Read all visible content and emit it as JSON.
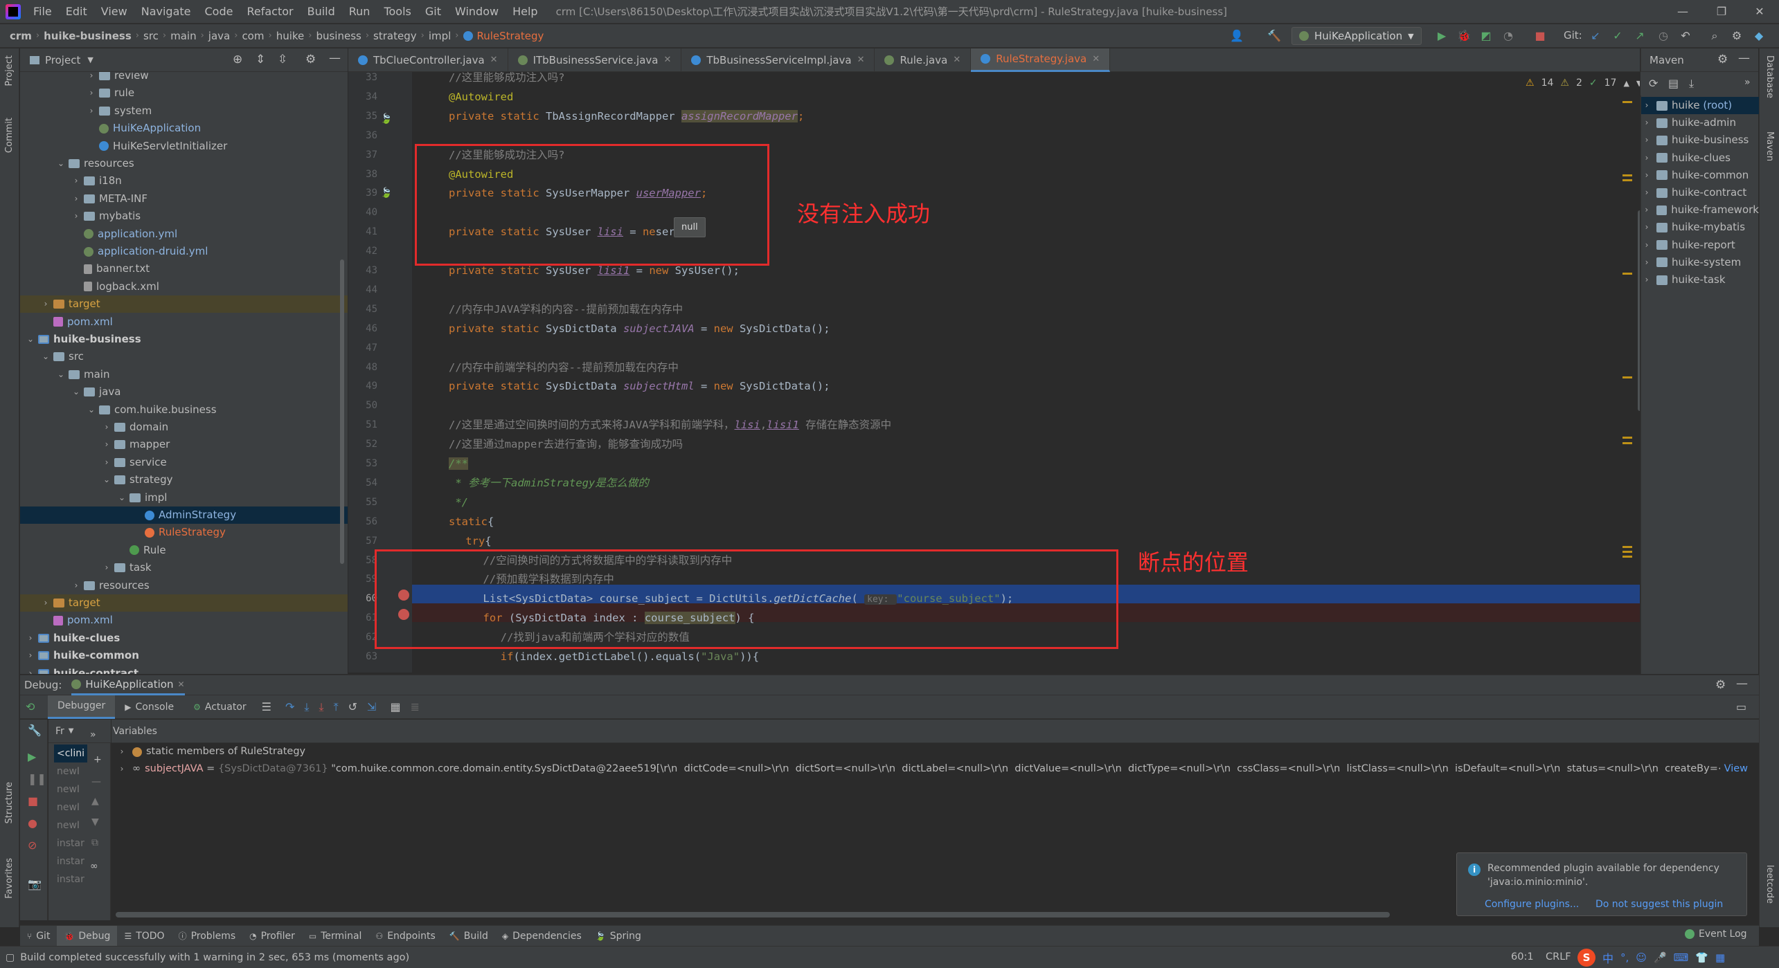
{
  "menu": {
    "items": [
      "File",
      "Edit",
      "View",
      "Navigate",
      "Code",
      "Refactor",
      "Build",
      "Run",
      "Tools",
      "Git",
      "Window",
      "Help"
    ],
    "title": "crm [C:\\Users\\86150\\Desktop\\工作\\沉浸式项目实战\\沉浸式项目实战V1.2\\代码\\第一天代码\\prd\\crm] - RuleStrategy.java [huike-business]"
  },
  "nav": {
    "crumbs": [
      "crm",
      "huike-business",
      "src",
      "main",
      "java",
      "com",
      "huike",
      "business",
      "strategy",
      "impl",
      "RuleStrategy"
    ],
    "run_config": "HuiKeApplication",
    "git_label": "Git:"
  },
  "left_strip": {
    "project": "Project",
    "commit": "Commit",
    "structure": "Structure",
    "favorites": "Favorites"
  },
  "right_strip": {
    "database": "Database",
    "maven": "Maven",
    "leetcode": "leetcode"
  },
  "project": {
    "title": "Project",
    "tree": [
      {
        "indent": 4,
        "chev": "›",
        "icon": "folder",
        "label": "review"
      },
      {
        "indent": 4,
        "chev": "›",
        "icon": "folder",
        "label": "rule"
      },
      {
        "indent": 4,
        "chev": "›",
        "icon": "folder",
        "label": "system"
      },
      {
        "indent": 4,
        "chev": "",
        "icon": "spring",
        "label": "HuiKeApplication",
        "cls": "blue"
      },
      {
        "indent": 4,
        "chev": "",
        "icon": "class",
        "label": "HuiKeServletInitializer"
      },
      {
        "indent": 2,
        "chev": "⌄",
        "icon": "folder",
        "label": "resources"
      },
      {
        "indent": 3,
        "chev": "›",
        "icon": "folder",
        "label": "i18n"
      },
      {
        "indent": 3,
        "chev": "›",
        "icon": "folder",
        "label": "META-INF"
      },
      {
        "indent": 3,
        "chev": "›",
        "icon": "folder",
        "label": "mybatis"
      },
      {
        "indent": 3,
        "chev": "",
        "icon": "spring",
        "label": "application.yml",
        "cls": "blue"
      },
      {
        "indent": 3,
        "chev": "",
        "icon": "spring",
        "label": "application-druid.yml",
        "cls": "blue"
      },
      {
        "indent": 3,
        "chev": "",
        "icon": "file",
        "label": "banner.txt"
      },
      {
        "indent": 3,
        "chev": "",
        "icon": "file",
        "label": "logback.xml"
      },
      {
        "indent": 1,
        "chev": "›",
        "icon": "folder-o",
        "label": "target",
        "cls": "orange",
        "row": "hl"
      },
      {
        "indent": 1,
        "chev": "",
        "icon": "mvn",
        "label": "pom.xml",
        "cls": "blue"
      },
      {
        "indent": 0,
        "chev": "⌄",
        "icon": "module",
        "label": "huike-business",
        "cls": "bold"
      },
      {
        "indent": 1,
        "chev": "⌄",
        "icon": "folder",
        "label": "src"
      },
      {
        "indent": 2,
        "chev": "⌄",
        "icon": "folder",
        "label": "main"
      },
      {
        "indent": 3,
        "chev": "⌄",
        "icon": "folder",
        "label": "java"
      },
      {
        "indent": 4,
        "chev": "⌄",
        "icon": "pkg",
        "label": "com.huike.business"
      },
      {
        "indent": 5,
        "chev": "›",
        "icon": "pkg",
        "label": "domain"
      },
      {
        "indent": 5,
        "chev": "›",
        "icon": "pkg",
        "label": "mapper"
      },
      {
        "indent": 5,
        "chev": "›",
        "icon": "pkg",
        "label": "service"
      },
      {
        "indent": 5,
        "chev": "⌄",
        "icon": "pkg",
        "label": "strategy"
      },
      {
        "indent": 6,
        "chev": "⌄",
        "icon": "pkg",
        "label": "impl"
      },
      {
        "indent": 7,
        "chev": "",
        "icon": "class",
        "label": "AdminStrategy",
        "cls": "blue",
        "row": "sel"
      },
      {
        "indent": 7,
        "chev": "",
        "icon": "class-orange",
        "label": "RuleStrategy",
        "cls": "red"
      },
      {
        "indent": 6,
        "chev": "",
        "icon": "rulecls",
        "label": "Rule"
      },
      {
        "indent": 5,
        "chev": "›",
        "icon": "pkg",
        "label": "task"
      },
      {
        "indent": 3,
        "chev": "›",
        "icon": "folder",
        "label": "resources"
      },
      {
        "indent": 1,
        "chev": "›",
        "icon": "folder-o",
        "label": "target",
        "cls": "orange",
        "row": "hl"
      },
      {
        "indent": 1,
        "chev": "",
        "icon": "mvn",
        "label": "pom.xml",
        "cls": "blue"
      },
      {
        "indent": 0,
        "chev": "›",
        "icon": "module",
        "label": "huike-clues",
        "cls": "bold"
      },
      {
        "indent": 0,
        "chev": "›",
        "icon": "module",
        "label": "huike-common",
        "cls": "bold"
      },
      {
        "indent": 0,
        "chev": "›",
        "icon": "module",
        "label": "huike-contract",
        "cls": "bold"
      }
    ]
  },
  "tabs": [
    {
      "label": "TbClueController.java",
      "icon": "cls",
      "active": false
    },
    {
      "label": "ITbBusinessService.java",
      "icon": "itf",
      "active": false
    },
    {
      "label": "TbBusinessServiceImpl.java",
      "icon": "cls",
      "active": false
    },
    {
      "label": "Rule.java",
      "icon": "itf",
      "active": false
    },
    {
      "label": "RuleStrategy.java",
      "icon": "cls",
      "active": true
    }
  ],
  "editor": {
    "inspections": {
      "warnings": "14",
      "weak": "2",
      "ok": "17"
    },
    "line_numbers": [
      "33",
      "34",
      "35",
      "36",
      "37",
      "38",
      "39",
      "40",
      "41",
      "42",
      "43",
      "44",
      "45",
      "46",
      "47",
      "48",
      "49",
      "50",
      "51",
      "52",
      "53",
      "54",
      "55",
      "56",
      "57",
      "58",
      "59",
      "60",
      "61",
      "62",
      "63"
    ],
    "lines": {
      "l33": "//这里能够成功注入吗?",
      "l34": "@Autowired",
      "l35a": "private static ",
      "l35b": "TbAssignRecordMapper ",
      "l35c": "assignRecordMapper",
      "l35d": ";",
      "l37": "//这里能够成功注入吗?",
      "l38": "@Autowired",
      "l39a": "private static ",
      "l39b": "SysUserMapper ",
      "l39c": "userMapper",
      "l39d": ";",
      "l41a": "private static ",
      "l41b": "SysUser ",
      "l41c": "lisi",
      "l41d": " = ",
      "l41e": "ne",
      "l41f": "ser();",
      "l43a": "private static ",
      "l43b": "SysUser ",
      "l43c": "lisi1",
      "l43d": " = ",
      "l43e": "new ",
      "l43f": "SysUser();",
      "l45": "//内存中JAVA学科的内容--提前预加载在内存中",
      "l46a": "private static ",
      "l46b": "SysDictData ",
      "l46c": "subjectJAVA",
      "l46d": " = ",
      "l46e": "new ",
      "l46f": "SysDictData();",
      "l48": "//内存中前端学科的内容--提前预加载在内存中",
      "l49a": "private static ",
      "l49b": "SysDictData ",
      "l49c": "subjectHtml",
      "l49d": " = ",
      "l49e": "new ",
      "l49f": "SysDictData();",
      "l51a": "//这里是通过空间换时间的方式来将JAVA学科和前端学科，",
      "l51b": "lisi",
      "l51c": ",",
      "l51d": "lisi1",
      "l51e": " 存储在静态资源中",
      "l52": "//这里通过mapper去进行查询，能够查询成功吗",
      "l53": "/**",
      "l54a": " * ",
      "l54b": "参考一下adminStrategy是怎么做的",
      "l55": " */",
      "l56a": "static",
      "l56b": "{",
      "l57a": "try",
      "l57b": "{",
      "l58": "//空间换时间的方式将数据库中的学科读取到内存中",
      "l59": "//预加载学科数据到内存中",
      "l60a": "List<SysDictData> course_subject = DictUtils.",
      "l60b": "getDictCache",
      "l60c": "( ",
      "l60d": "key: ",
      "l60e": "\"course_subject\"",
      "l60f": ");",
      "l61a": "for ",
      "l61b": "(SysDictData index : ",
      "l61c": "course_subject",
      "l61d": ") {",
      "l62": "//找到java和前端两个学科对应的数值",
      "l63a": "if",
      "l63b": "(index.getDictLabel().equals(",
      "l63c": "\"Java\"",
      "l63d": ")){"
    },
    "tooltip": "null",
    "annotation_1": "没有注入成功",
    "annotation_2": "断点的位置"
  },
  "maven": {
    "title": "Maven",
    "items": [
      {
        "label": "huike",
        "suffix": " (root)",
        "sel": true
      },
      {
        "label": "huike-admin"
      },
      {
        "label": "huike-business"
      },
      {
        "label": "huike-clues"
      },
      {
        "label": "huike-common"
      },
      {
        "label": "huike-contract"
      },
      {
        "label": "huike-framework"
      },
      {
        "label": "huike-mybatis"
      },
      {
        "label": "huike-report"
      },
      {
        "label": "huike-system"
      },
      {
        "label": "huike-task"
      }
    ]
  },
  "debug": {
    "label": "Debug:",
    "session": "HuiKeApplication",
    "tabs": [
      "Debugger",
      "Console",
      "Actuator"
    ],
    "frames_label": "Fr",
    "variables_label": "Variables",
    "frames": [
      "<clini",
      "newI",
      "newI",
      "newI",
      "newI",
      "instar",
      "instar",
      "instar"
    ],
    "var1_label": "static members of RuleStrategy",
    "var2_name": "subjectJAVA",
    "var2_eq": " = ",
    "var2_ref": "{SysDictData@7361}",
    "var2_value": " \"com.huike.common.core.domain.entity.SysDictData@22aee519[\\r\\n  dictCode=<null>\\r\\n  dictSort=<null>\\r\\n  dictLabel=<null>\\r\\n  dictValue=<null>\\r\\n  dictType=<null>\\r\\n  cssClass=<null>\\r\\n  listClass=<null>\\r\\n  isDefault=<null>\\r\\n  status=<null>\\r\\n  createBy=<null...",
    "var2_view": "View"
  },
  "notification": {
    "text": "Recommended plugin available for dependency 'java:io.minio:minio'.",
    "configure": "Configure plugins...",
    "dont_suggest": "Do not suggest this plugin"
  },
  "bottom_tabs": [
    "Git",
    "Debug",
    "TODO",
    "Problems",
    "Profiler",
    "Terminal",
    "Endpoints",
    "Build",
    "Dependencies",
    "Spring"
  ],
  "event_log": "Event Log",
  "status": {
    "message": "Build completed successfully with 1 warning in 2 sec, 653 ms (moments ago)",
    "position": "60:1",
    "line_sep": "CRLF",
    "ime": "中"
  },
  "colors": {
    "accent": "#4a88c7",
    "annotation_red": "#e22b2b",
    "selection": "#214283"
  }
}
